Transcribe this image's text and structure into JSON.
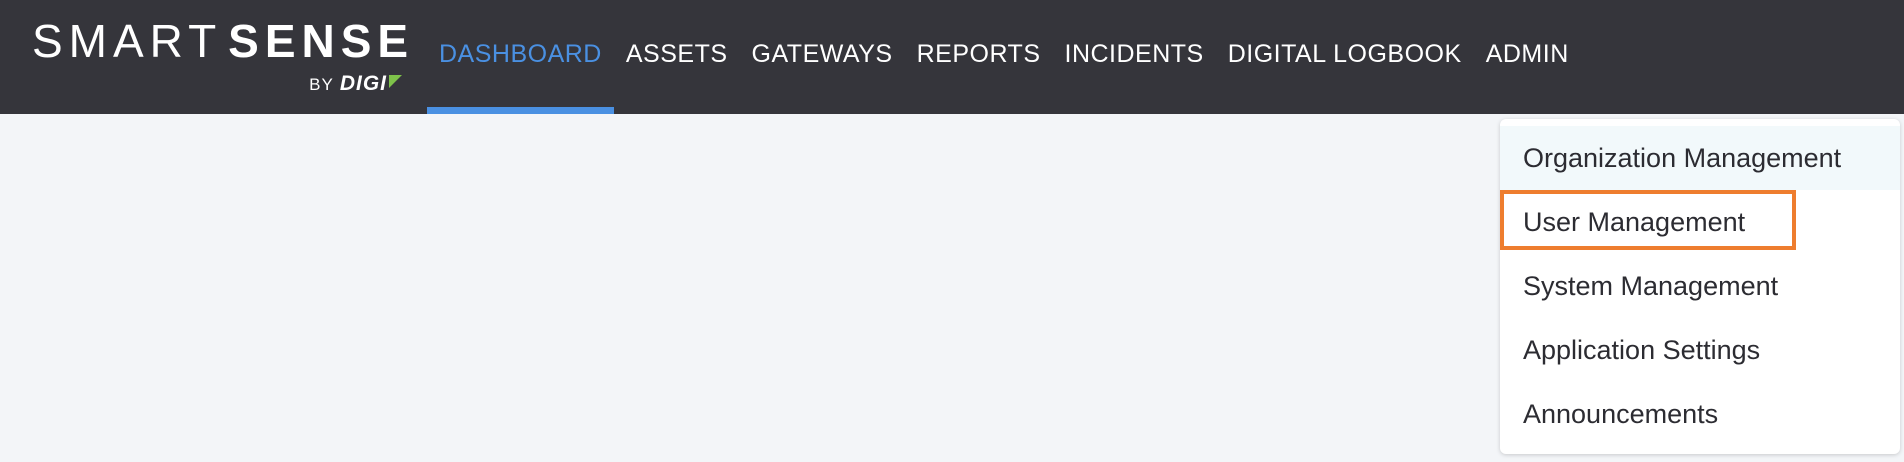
{
  "brand": {
    "smart": "SMART",
    "sense": "SENSE",
    "by": "BY",
    "digi": "DIGI",
    "accent_color": "#7ec24a"
  },
  "nav": {
    "items": [
      {
        "label": "DASHBOARD",
        "active": true
      },
      {
        "label": "ASSETS",
        "active": false
      },
      {
        "label": "GATEWAYS",
        "active": false
      },
      {
        "label": "REPORTS",
        "active": false
      },
      {
        "label": "INCIDENTS",
        "active": false
      },
      {
        "label": "DIGITAL LOGBOOK",
        "active": false
      },
      {
        "label": "ADMIN",
        "active": false
      }
    ],
    "active_color": "#4a90e2",
    "background_color": "#35353b"
  },
  "admin_menu": {
    "items": [
      {
        "label": "Organization Management"
      },
      {
        "label": "User Management"
      },
      {
        "label": "System Management"
      },
      {
        "label": "Application Settings"
      },
      {
        "label": "Announcements"
      }
    ],
    "highlight_color": "#ee7d2e"
  }
}
